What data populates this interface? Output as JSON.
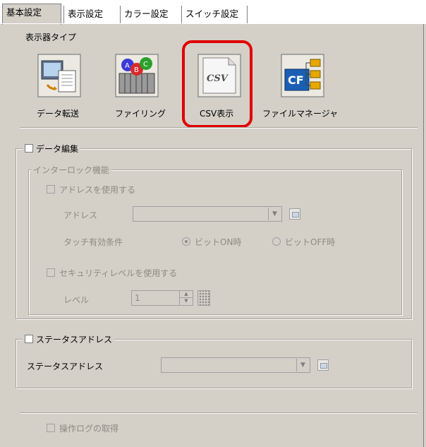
{
  "tabs": [
    {
      "label": "基本設定",
      "active": true
    },
    {
      "label": "表示設定",
      "active": false
    },
    {
      "label": "カラー設定",
      "active": false
    },
    {
      "label": "スイッチ設定",
      "active": false
    }
  ],
  "display_type": {
    "heading": "表示器タイプ",
    "items": [
      {
        "label": "データ転送",
        "icon": "data-transfer-icon"
      },
      {
        "label": "ファイリング",
        "icon": "filing-icon"
      },
      {
        "label": "CSV表示",
        "icon": "csv-display-icon",
        "icon_text": "CSV",
        "selected": true
      },
      {
        "label": "ファイルマネージャ",
        "icon": "file-manager-icon",
        "icon_text": "CF"
      }
    ]
  },
  "data_edit": {
    "checkbox_label": "データ編集",
    "checked": false,
    "interlock": {
      "legend": "インターロック機能",
      "use_address_label": "アドレスを使用する",
      "address_label": "アドレス",
      "address_value": "",
      "touch_condition_label": "タッチ有効条件",
      "radio_on_label": "ビットON時",
      "radio_off_label": "ビットOFF時",
      "selected_radio": "on",
      "use_security_label": "セキュリティレベルを使用する",
      "level_label": "レベル",
      "level_value": "1"
    }
  },
  "status_address": {
    "checkbox_label": "ステータスアドレス",
    "checked": false,
    "field_label": "ステータスアドレス",
    "field_value": ""
  },
  "operation_log": {
    "checkbox_label": "操作ログの取得",
    "checked": false
  },
  "colors": {
    "background": "#d4d0c8",
    "selection_ring": "#e00000",
    "disabled_text": "#8c8a82"
  }
}
